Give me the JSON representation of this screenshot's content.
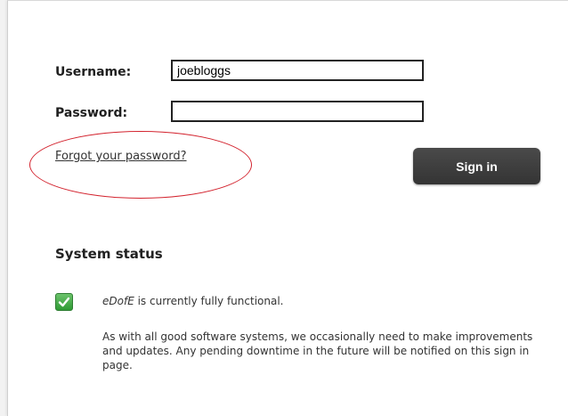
{
  "login": {
    "username_label": "Username:",
    "username_value": "joebloggs",
    "password_label": "Password:",
    "password_value": "",
    "forgot_link": "Forgot your password?",
    "signin_label": "Sign in"
  },
  "status": {
    "title": "System status",
    "app_name": "eDofE",
    "message": " is currently fully functional.",
    "description": "As with all good software systems, we occasionally need to make improvements and updates. Any pending downtime in the future will be notified on this sign in page."
  },
  "colors": {
    "annotation_ellipse": "#d3232e",
    "signin_button": "#3c3c3c",
    "check_green": "#3aa53f"
  },
  "icons": {
    "status": "check-icon"
  }
}
